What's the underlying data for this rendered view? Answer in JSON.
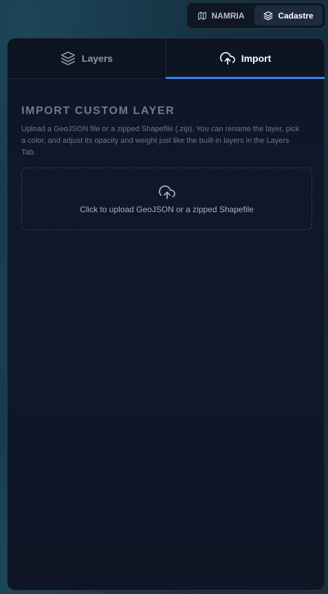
{
  "base_toggle": {
    "namria_label": "NAMRIA",
    "cadastre_label": "Cadastre",
    "selected": "Cadastre"
  },
  "tabs": [
    {
      "label": "Layers",
      "icon": "layers-icon",
      "active": false
    },
    {
      "label": "Import",
      "icon": "cloud-upload-icon",
      "active": true
    }
  ],
  "import": {
    "title": "IMPORT CUSTOM LAYER",
    "description": "Upload a GeoJSON file or a zipped Shapefile (.zip). You can rename the layer, pick a color, and adjust its opacity and weight just like the built-in layers in the Layers Tab.",
    "upload_label": "Click to upload GeoJSON or a zipped Shapefile",
    "upload_icon": "cloud-upload-icon"
  },
  "colors": {
    "accent": "#3b7ff2",
    "panel_bg": "#0e1727",
    "map_bg": "#163445"
  }
}
